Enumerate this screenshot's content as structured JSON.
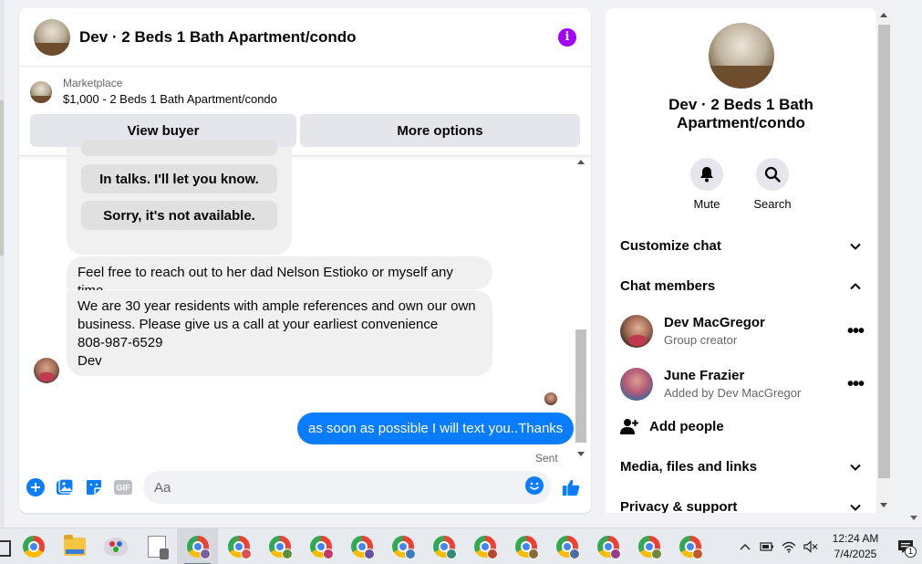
{
  "chat": {
    "title": "Dev · 2 Beds 1 Bath Apartment/condo",
    "listing": {
      "source": "Marketplace",
      "name": "$1,000 - 2 Beds 1 Bath Apartment/condo",
      "view_buyer": "View buyer",
      "more_options": "More options"
    },
    "quick_replies": [
      "In talks. I'll let you know.",
      "Sorry, it's not available."
    ],
    "messages": {
      "m1": "Feel free to reach out to her dad Nelson Estioko or myself any time",
      "m2_lines": [
        "We are 30 year residents with ample references and own our own",
        "business. Please give us a call at your earliest convenience",
        "808-987-6529",
        "Dev"
      ],
      "mine": "as soon as possible I will text you..Thanks",
      "status": "Sent"
    },
    "composer": {
      "placeholder": "Aa",
      "icons": [
        "plus-icon",
        "image-icon",
        "sticker-icon",
        "gif-icon",
        "emoji-icon",
        "thumbs-up-icon"
      ],
      "gif_label": "GIF"
    },
    "colors": {
      "accent": "#0a7cff",
      "info": "#a200ff"
    }
  },
  "info_panel": {
    "title": "Dev · 2 Beds 1 Bath Apartment/condo",
    "actions": {
      "mute": "Mute",
      "search": "Search"
    },
    "sections": {
      "customize": "Customize chat",
      "members": "Chat members",
      "media": "Media, files and links",
      "privacy": "Privacy & support"
    },
    "members": [
      {
        "name": "Dev MacGregor",
        "sub": "Group creator"
      },
      {
        "name": "June Frazier",
        "sub": "Added by Dev MacGregor"
      }
    ],
    "add_people": "Add people"
  },
  "taskbar": {
    "time": "12:24 AM",
    "date": "7/4/2025",
    "notification_count": "1"
  }
}
